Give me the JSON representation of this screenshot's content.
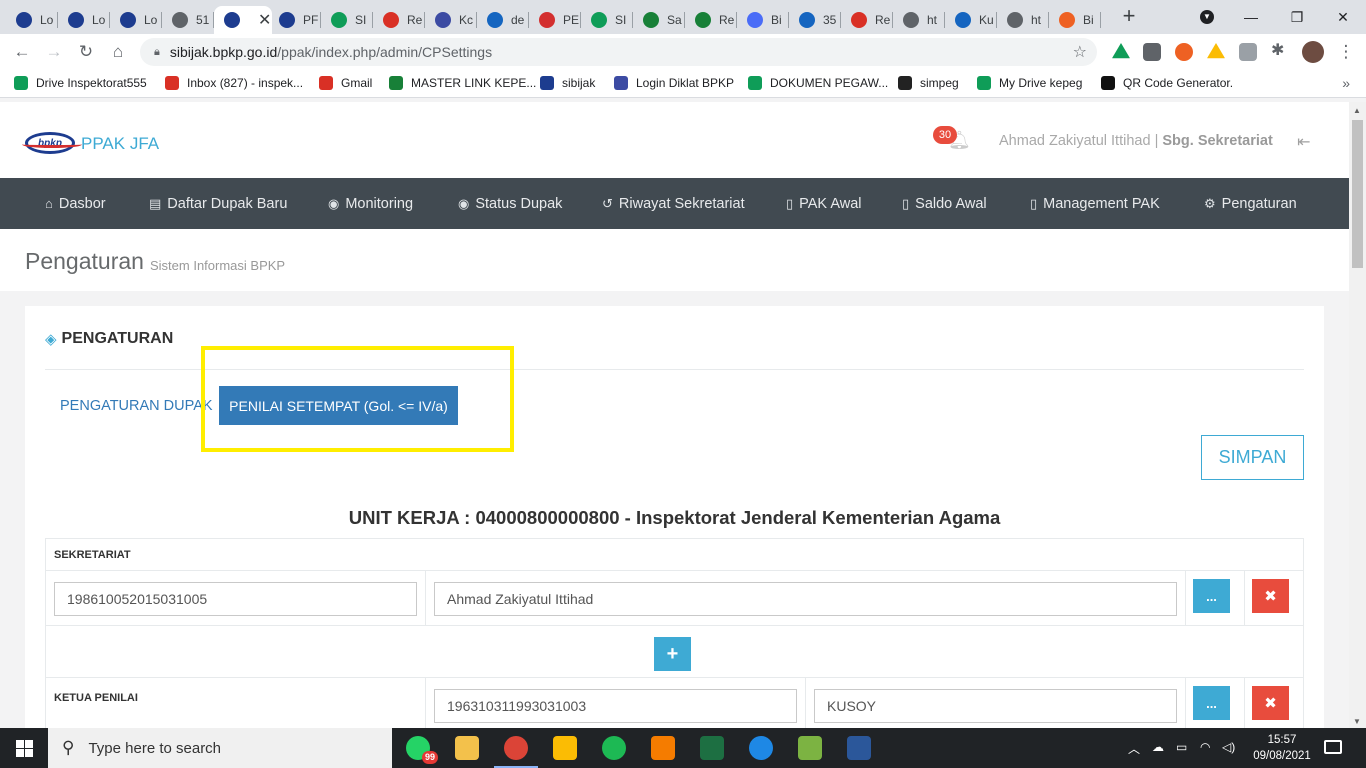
{
  "browser": {
    "tabs": [
      {
        "label": "Lo",
        "icon": "bpkp-icon",
        "color": "#1d3c8f"
      },
      {
        "label": "Lo",
        "icon": "bpkp-icon",
        "color": "#1d3c8f"
      },
      {
        "label": "Lo",
        "icon": "bpkp-icon",
        "color": "#1d3c8f"
      },
      {
        "label": "51",
        "icon": "globe-icon",
        "color": "#5f6368"
      },
      {
        "label": "",
        "icon": "bpkp-icon",
        "color": "#1d3c8f",
        "active": true
      },
      {
        "label": "PF",
        "icon": "bpkp-icon",
        "color": "#1d3c8f"
      },
      {
        "label": "SI",
        "icon": "drive-icon",
        "color": "#0f9d58"
      },
      {
        "label": "Re",
        "icon": "gmail-icon",
        "color": "#d93025"
      },
      {
        "label": "Kc",
        "icon": "diklat-icon",
        "color": "#3c4ba3"
      },
      {
        "label": "de",
        "icon": "d-icon",
        "color": "#1565c0"
      },
      {
        "label": "PE",
        "icon": "pe-icon",
        "color": "#d32f2f"
      },
      {
        "label": "SI",
        "icon": "drive-icon",
        "color": "#0f9d58"
      },
      {
        "label": "Sa",
        "icon": "sheets-icon",
        "color": "#188038"
      },
      {
        "label": "Re",
        "icon": "sheets-icon",
        "color": "#188038"
      },
      {
        "label": "Bi",
        "icon": "b-icon",
        "color": "#4a6cf7"
      },
      {
        "label": "35",
        "icon": "d-icon",
        "color": "#1565c0"
      },
      {
        "label": "Re",
        "icon": "gmail-icon",
        "color": "#d93025"
      },
      {
        "label": "ht",
        "icon": "globe-icon",
        "color": "#5f6368"
      },
      {
        "label": "Ku",
        "icon": "d-icon",
        "color": "#1565c0"
      },
      {
        "label": "ht",
        "icon": "globe-icon",
        "color": "#5f6368"
      },
      {
        "label": "Bi",
        "icon": "bitly-icon",
        "color": "#ee6123"
      }
    ],
    "url_host": "sibijak.bpkp.go.id",
    "url_path": "/ppak/index.php/admin/CPSettings",
    "bookmarks": [
      {
        "label": "Drive Inspektorat555",
        "icon": "drive-icon",
        "color": "#0f9d58"
      },
      {
        "label": "Inbox (827) - inspek...",
        "icon": "gmail-icon",
        "color": "#d93025"
      },
      {
        "label": "Gmail",
        "icon": "gmail-icon",
        "color": "#d93025"
      },
      {
        "label": "MASTER LINK KEPE...",
        "icon": "sheets-icon",
        "color": "#188038"
      },
      {
        "label": "sibijak",
        "icon": "bpkp-icon",
        "color": "#1d3c8f"
      },
      {
        "label": "Login Diklat BPKP",
        "icon": "diklat-icon",
        "color": "#3c4ba3"
      },
      {
        "label": "DOKUMEN PEGAW...",
        "icon": "drive-icon",
        "color": "#0f9d58"
      },
      {
        "label": "simpeg",
        "icon": "simpeg-icon",
        "color": "#222222"
      },
      {
        "label": "My Drive kepeg",
        "icon": "drive-icon",
        "color": "#0f9d58"
      },
      {
        "label": "QR Code Generator.",
        "icon": "qr-icon",
        "color": "#111111"
      }
    ]
  },
  "app": {
    "brand": "PPAK JFA",
    "logo_text": "bpkp",
    "notif_count": "30",
    "user_name": "Ahmad Zakiyatul Ittihad",
    "user_sep": "|",
    "user_role": "Sbg. Sekretariat",
    "nav": [
      {
        "label": "Dasbor",
        "icon": "home-icon",
        "glyph": "⌂"
      },
      {
        "label": "Daftar Dupak Baru",
        "icon": "list-icon",
        "glyph": "▤"
      },
      {
        "label": "Monitoring",
        "icon": "eye-icon",
        "glyph": "◉"
      },
      {
        "label": "Status Dupak",
        "icon": "eye-icon",
        "glyph": "◉"
      },
      {
        "label": "Riwayat Sekretariat",
        "icon": "history-icon",
        "glyph": "↺"
      },
      {
        "label": "PAK Awal",
        "icon": "file-icon",
        "glyph": "▯"
      },
      {
        "label": "Saldo Awal",
        "icon": "file-icon",
        "glyph": "▯"
      },
      {
        "label": "Management PAK",
        "icon": "file-icon",
        "glyph": "▯"
      },
      {
        "label": "Pengaturan",
        "icon": "gear-icon",
        "glyph": "⚙"
      }
    ],
    "page_title": "Pengaturan",
    "page_subtitle": "Sistem Informasi BPKP",
    "card_title": "PENGATURAN",
    "tab_1": "PENGATURAN DUPAK",
    "tab_2": "PENILAI SETEMPAT (Gol. <= IV/a)",
    "save_label": "SIMPAN",
    "unit_title": "UNIT KERJA : 04000800000800 - Inspektorat Jenderal Kementerian Agama",
    "sekretariat": {
      "label": "SEKRETARIAT",
      "nip": "198610052015031005",
      "name": "Ahmad Zakiyatul Ittihad",
      "dots": "...",
      "del": "✖"
    },
    "add_label": "+",
    "ketua": {
      "label": "KETUA PENILAI",
      "nip": "196310311993031003",
      "name": "KUSOY",
      "dots": "...",
      "del": "✖"
    }
  },
  "taskbar": {
    "search_placeholder": "Type here to search",
    "whatsapp_badge": "99",
    "time": "15:57",
    "date": "09/08/2021",
    "apps": [
      {
        "name": "whatsapp-icon",
        "color": "#25d366"
      },
      {
        "name": "file-explorer-icon",
        "color": "#f3c14b"
      },
      {
        "name": "chrome-icon",
        "color": "#db4437"
      },
      {
        "name": "google-keep-icon",
        "color": "#fbbc04"
      },
      {
        "name": "spotify-icon",
        "color": "#1db954"
      },
      {
        "name": "pdf-app-icon",
        "color": "#f57c00"
      },
      {
        "name": "excel-icon",
        "color": "#1d6f42"
      },
      {
        "name": "edge-icon",
        "color": "#1e88e5"
      },
      {
        "name": "paint-icon",
        "color": "#7cb342"
      },
      {
        "name": "word-icon",
        "color": "#2b579a"
      }
    ]
  },
  "colors": {
    "accent": "#3eaad4",
    "primary": "#337ab7",
    "danger": "#e84c3d",
    "navbar": "#414a51",
    "highlight": "#ffee00"
  }
}
